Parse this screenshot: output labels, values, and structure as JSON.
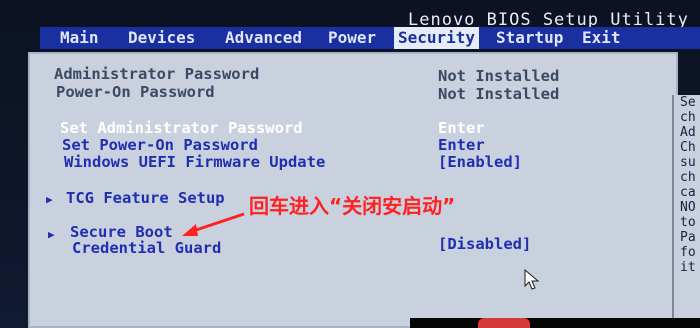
{
  "app_title": "Lenovo BIOS Setup Utility",
  "menu": [
    {
      "label": "Main",
      "active": false
    },
    {
      "label": "Devices",
      "active": false
    },
    {
      "label": "Advanced",
      "active": false
    },
    {
      "label": "Power",
      "active": false
    },
    {
      "label": "Security",
      "active": true
    },
    {
      "label": "Startup",
      "active": false
    },
    {
      "label": "Exit",
      "active": false
    }
  ],
  "security": {
    "admin_password_label": "Administrator Password",
    "admin_password_value": "Not Installed",
    "poweron_password_label": "Power-On Password",
    "poweron_password_value": "Not Installed",
    "set_admin_label": "Set Administrator Password",
    "set_admin_value": "Enter",
    "set_poweron_label": "Set Power-On Password",
    "set_poweron_value": "Enter",
    "uefi_update_label": "Windows UEFI Firmware Update",
    "uefi_update_value": "[Enabled]",
    "tcg_label": "TCG Feature Setup",
    "secure_boot_label": "Secure Boot",
    "credential_guard_label": "Credential Guard",
    "credential_guard_value": "[Disabled]"
  },
  "help_lines": [
    "Se",
    "ch",
    "Ad",
    "Ch",
    "su",
    "ch",
    "ca",
    "NO",
    "to",
    "Pa",
    "fo",
    "it"
  ],
  "annotation": "回车进入“关闭安启动”",
  "colors": {
    "menubar": "#1a2fa0",
    "panel": "#c9d1de",
    "annotation": "#ff2020"
  }
}
